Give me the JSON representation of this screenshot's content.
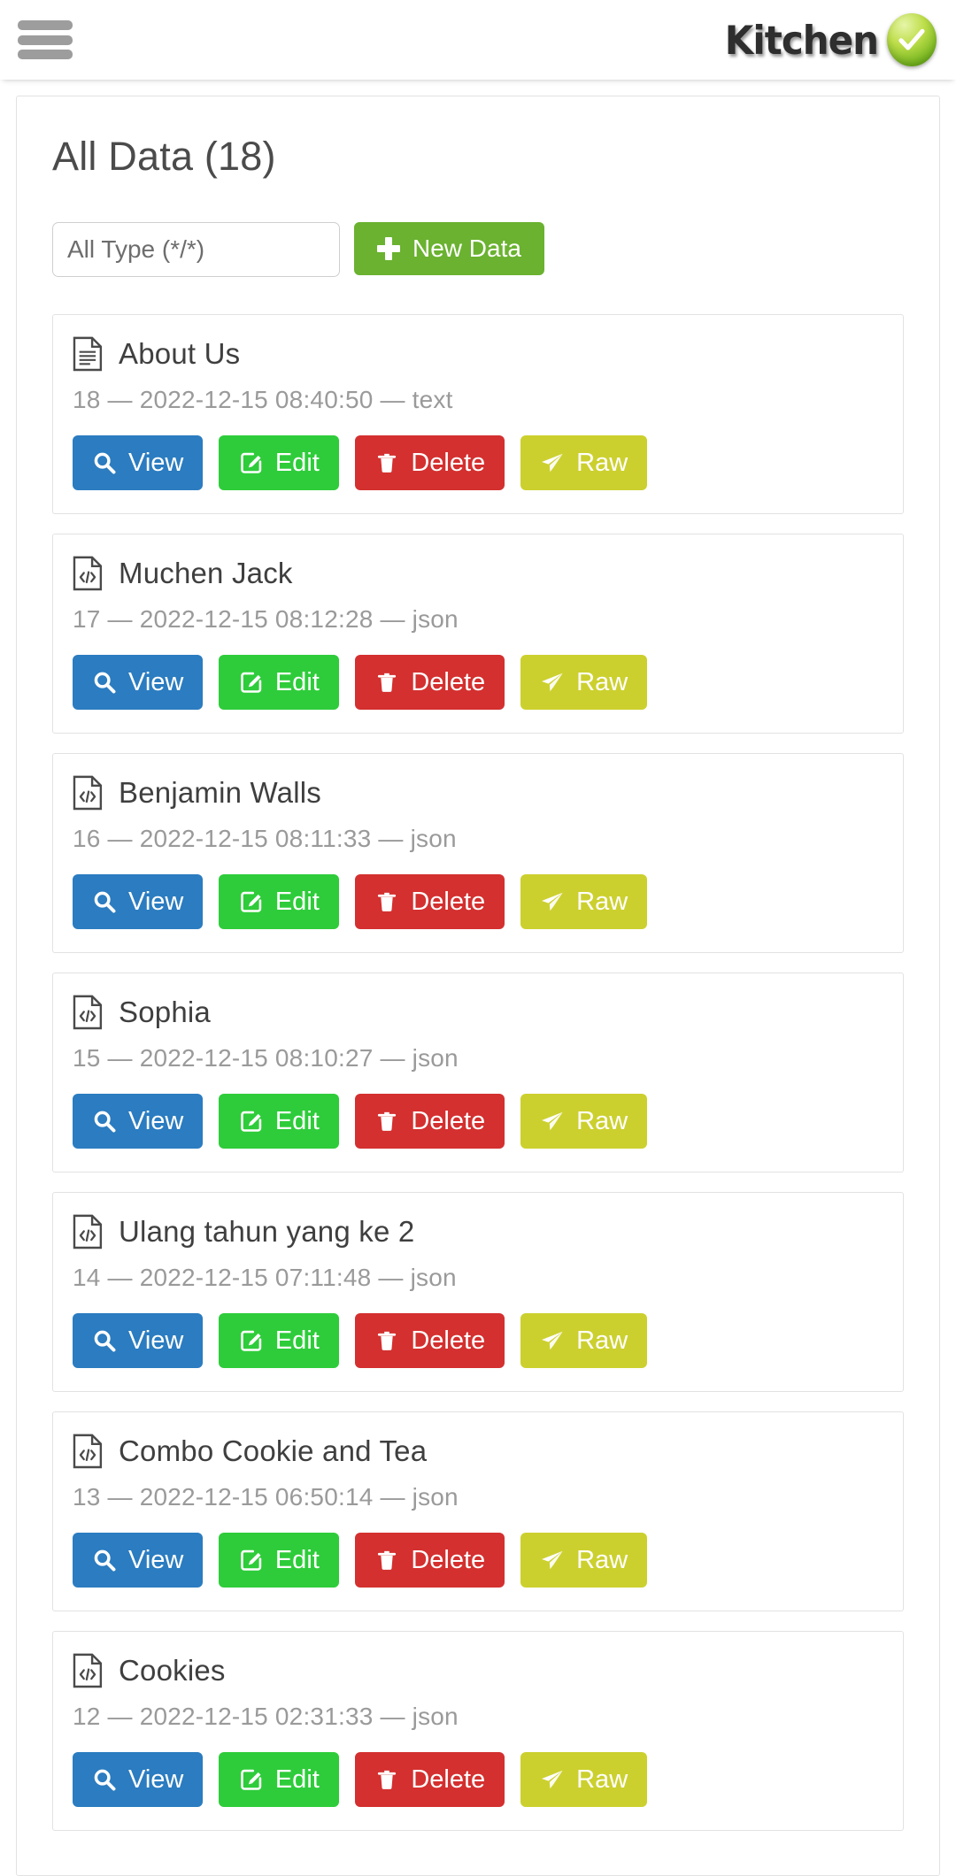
{
  "header": {
    "menu_icon": "hamburger-menu-icon",
    "brand_text": "Kitchen",
    "brand_badge_icon": "check-badge-icon"
  },
  "page": {
    "title": "All Data (18)",
    "count": 18
  },
  "toolbar": {
    "type_filter_value": "All Type (*/*)",
    "new_button_label": "New Data",
    "new_button_icon": "plus-icon",
    "new_button_color": "#6ab22f"
  },
  "actions": {
    "view": {
      "label": "View",
      "icon": "search-icon",
      "color": "#2b7cc0"
    },
    "edit": {
      "label": "Edit",
      "icon": "pencil-square-icon",
      "color": "#2ecc3a"
    },
    "delete": {
      "label": "Delete",
      "icon": "trash-icon",
      "color": "#d3302f"
    },
    "raw": {
      "label": "Raw",
      "icon": "paper-plane-icon",
      "color": "#ccd02e"
    }
  },
  "items": [
    {
      "id": "18",
      "title": "About Us",
      "timestamp": "2022-12-15 08:40:50",
      "type": "text",
      "icon": "file-text-icon",
      "meta": "18 — 2022-12-15 08:40:50 — text"
    },
    {
      "id": "17",
      "title": "Muchen Jack",
      "timestamp": "2022-12-15 08:12:28",
      "type": "json",
      "icon": "file-code-icon",
      "meta": "17 — 2022-12-15 08:12:28 — json"
    },
    {
      "id": "16",
      "title": "Benjamin Walls",
      "timestamp": "2022-12-15 08:11:33",
      "type": "json",
      "icon": "file-code-icon",
      "meta": "16 — 2022-12-15 08:11:33 — json"
    },
    {
      "id": "15",
      "title": "Sophia",
      "timestamp": "2022-12-15 08:10:27",
      "type": "json",
      "icon": "file-code-icon",
      "meta": "15 — 2022-12-15 08:10:27 — json"
    },
    {
      "id": "14",
      "title": "Ulang tahun yang ke 2",
      "timestamp": "2022-12-15 07:11:48",
      "type": "json",
      "icon": "file-code-icon",
      "meta": "14 — 2022-12-15 07:11:48 — json"
    },
    {
      "id": "13",
      "title": "Combo Cookie and Tea",
      "timestamp": "2022-12-15 06:50:14",
      "type": "json",
      "icon": "file-code-icon",
      "meta": "13 — 2022-12-15 06:50:14 — json"
    },
    {
      "id": "12",
      "title": "Cookies",
      "timestamp": "2022-12-15 02:31:33",
      "type": "json",
      "icon": "file-code-icon",
      "meta": "12 — 2022-12-15 02:31:33 — json"
    }
  ]
}
